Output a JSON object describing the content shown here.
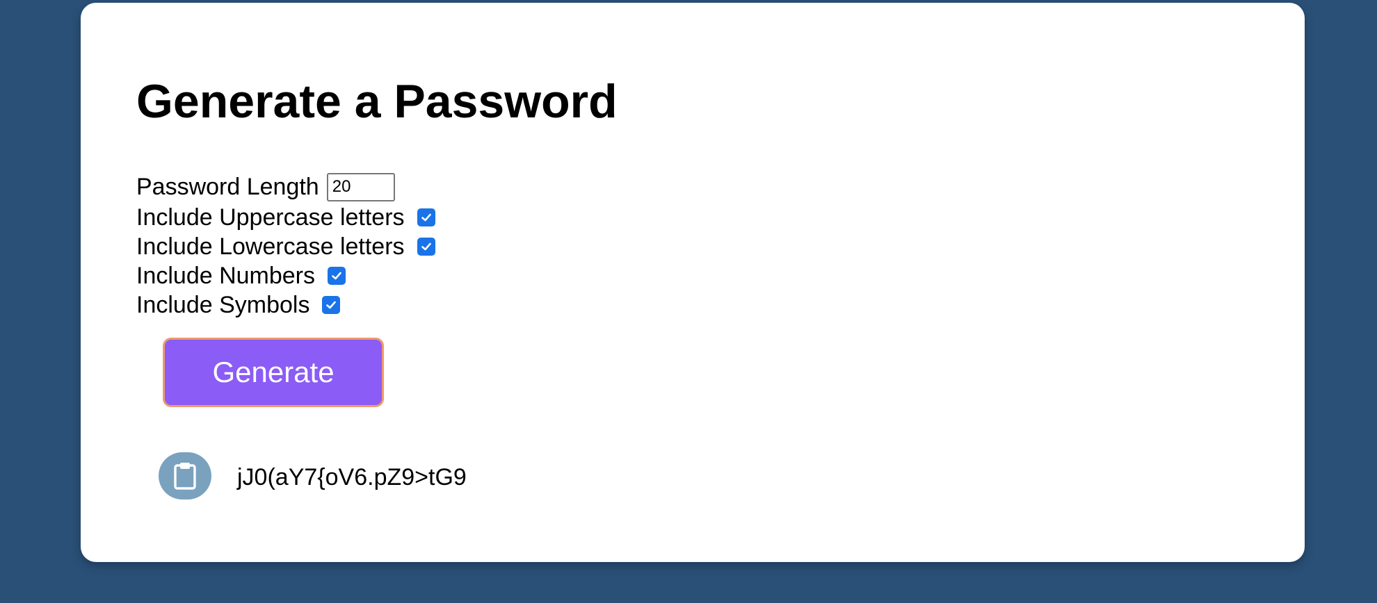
{
  "page": {
    "title": "Generate a Password"
  },
  "options": {
    "length_label": "Password Length",
    "length_value": "20",
    "uppercase_label": "Include Uppercase letters",
    "uppercase_checked": true,
    "lowercase_label": "Include Lowercase letters",
    "lowercase_checked": true,
    "numbers_label": "Include Numbers",
    "numbers_checked": true,
    "symbols_label": "Include Symbols",
    "symbols_checked": true
  },
  "actions": {
    "generate_label": "Generate",
    "copy_icon": "clipboard-icon"
  },
  "result": {
    "password": "jJ0(aY7{oV6.pZ9>tG9"
  },
  "colors": {
    "background": "#2a5078",
    "card": "#ffffff",
    "button": "#8b5cf6",
    "button_border": "#ee9a6d",
    "checkbox": "#1a73e8",
    "clipboard_button": "#7aa2bf"
  }
}
